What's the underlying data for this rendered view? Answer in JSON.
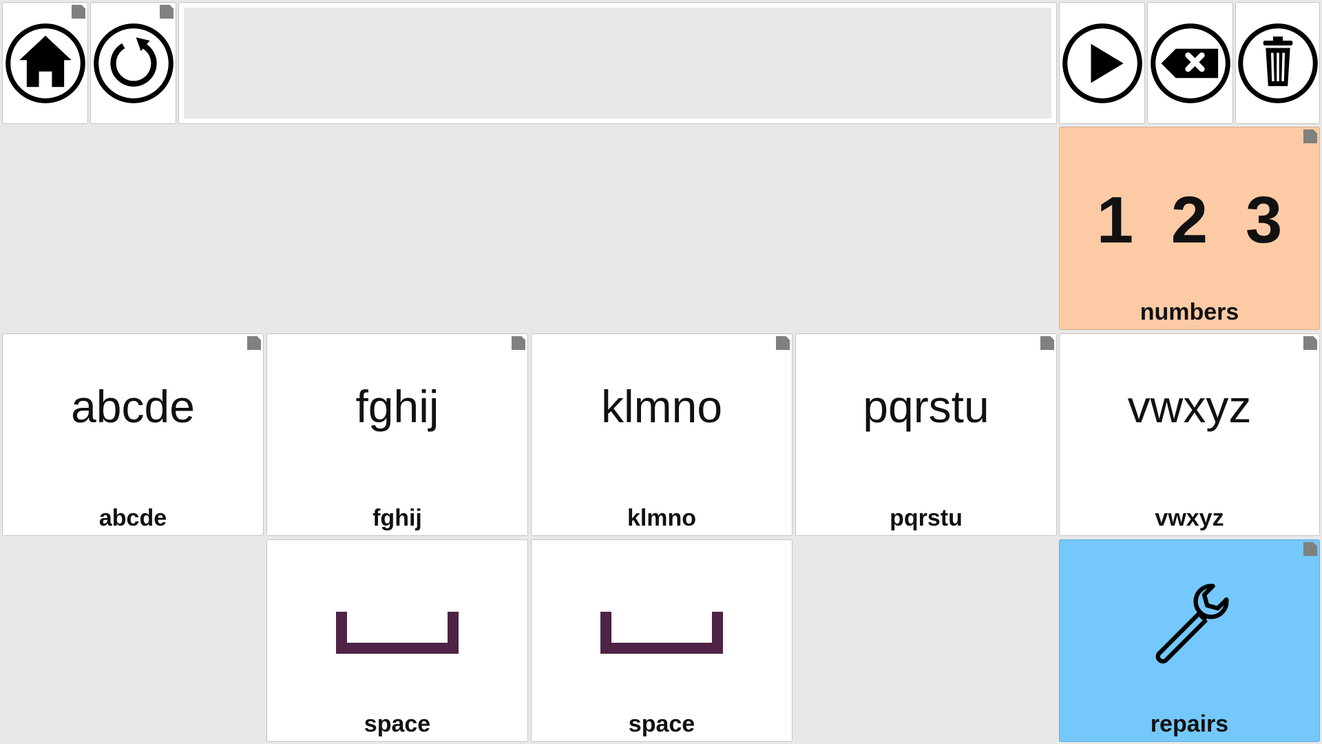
{
  "top_bar": {
    "message": ""
  },
  "tiles": {
    "numbers": {
      "symbol": "1 2 3",
      "label": "numbers",
      "color": "#fccba5"
    },
    "abcde": {
      "symbol": "abcde",
      "label": "abcde"
    },
    "fghij": {
      "symbol": "fghij",
      "label": "fghij"
    },
    "klmno": {
      "symbol": "klmno",
      "label": "klmno"
    },
    "pqrstu": {
      "symbol": "pqrstu",
      "label": "pqrstu"
    },
    "vwxyz": {
      "symbol": "vwxyz",
      "label": "vwxyz"
    },
    "space_1": {
      "icon": "space-bracket-icon",
      "label": "space",
      "icon_color": "#4e2346"
    },
    "space_2": {
      "icon": "space-bracket-icon",
      "label": "space",
      "icon_color": "#4e2346"
    },
    "repairs": {
      "icon": "wrench-icon",
      "label": "repairs",
      "color": "#74c8fc"
    }
  },
  "icons": {
    "home": "home-icon",
    "undo": "undo-icon",
    "speak": "play-icon",
    "backspace": "backspace-icon",
    "clear": "trash-icon"
  }
}
